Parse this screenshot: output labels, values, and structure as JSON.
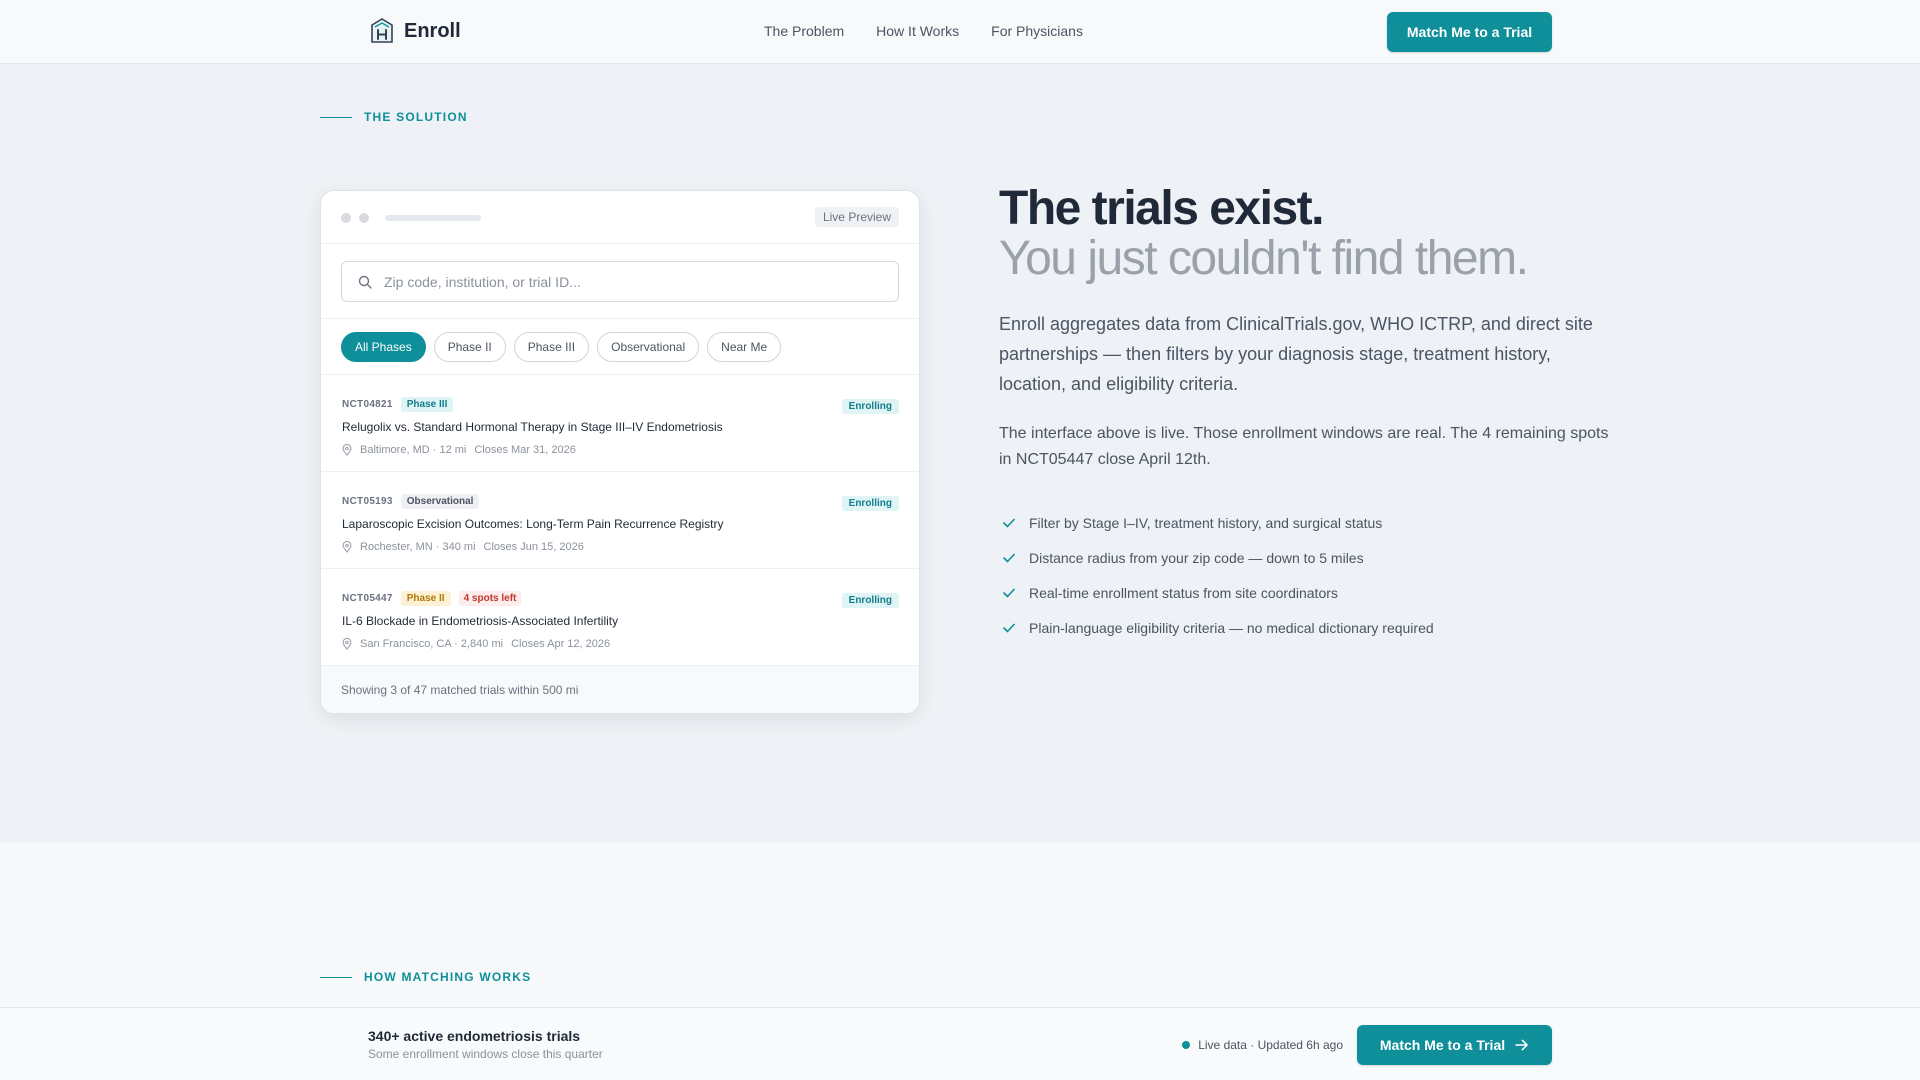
{
  "header": {
    "brand": "Enroll",
    "nav": [
      "The Problem",
      "How It Works",
      "For Physicians"
    ],
    "cta_label": "Match Me to a Trial"
  },
  "solution": {
    "eyebrow": "THE SOLUTION",
    "card": {
      "badge": "Live Preview",
      "search_placeholder": "Zip code, institution, or trial ID...",
      "filters": [
        "All Phases",
        "Phase II",
        "Phase III",
        "Observational",
        "Near Me"
      ],
      "active_filter": "All Phases",
      "trials": [
        {
          "id": "NCT04821",
          "phase": "Phase III",
          "status": "Enrolling",
          "title": "Relugolix vs. Standard Hormonal Therapy in Stage III–IV Endometriosis",
          "location": "Baltimore, MD · 12 mi",
          "closes": "Closes Mar 31, 2026"
        },
        {
          "id": "NCT05193",
          "phase": "Observational",
          "status": "Enrolling",
          "title": "Laparoscopic Excision Outcomes: Long-Term Pain Recurrence Registry",
          "location": "Rochester, MN · 340 mi",
          "closes": "Closes Jun 15, 2026"
        },
        {
          "id": "NCT05447",
          "phase": "Phase II",
          "spots": "4 spots left",
          "status": "Enrolling",
          "title": "IL-6 Blockade in Endometriosis-Associated Infertility",
          "location": "San Francisco, CA · 2,840 mi",
          "closes": "Closes Apr 12, 2026"
        }
      ],
      "footer": "Showing 3 of 47 matched trials within 500 mi"
    },
    "headline_bold": "The trials exist.",
    "headline_light": "You just couldn't find them.",
    "lead": "Enroll aggregates data from ClinicalTrials.gov, WHO ICTRP, and direct site partnerships — then filters by your diagnosis stage, treatment history, location, and eligibility criteria.",
    "lead2": "The interface above is live. Those enrollment windows are real. The 4 remaining spots in NCT05447 close April 12th.",
    "features": [
      "Filter by Stage I–IV, treatment history, and surgical status",
      "Distance radius from your zip code — down to 5 miles",
      "Real-time enrollment status from site coordinators",
      "Plain-language eligibility criteria — no medical dictionary required"
    ]
  },
  "how": {
    "eyebrow": "HOW MATCHING WORKS"
  },
  "sticky": {
    "title": "340+ active endometriosis trials",
    "subtitle": "Some enrollment windows close this quarter",
    "live": "Live data · Updated 6h ago",
    "cta_label": "Match Me to a Trial"
  },
  "colors": {
    "accent": "#0e8f9a",
    "phase2": "#b07a0a",
    "spots": "#c0392b"
  }
}
